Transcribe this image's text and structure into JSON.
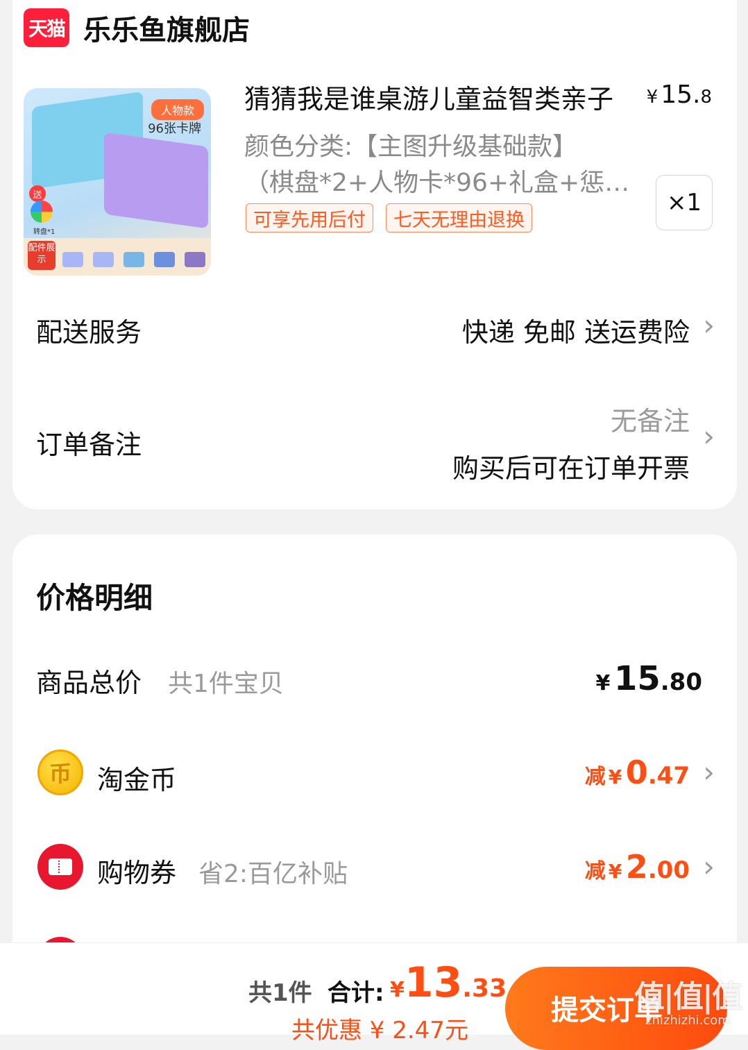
{
  "store": {
    "logo_text": "天猫",
    "name": "乐乐鱼旗舰店"
  },
  "product": {
    "image_tag": "人物款",
    "image_sub": "96张卡牌",
    "image_gift": "送",
    "image_spinner": "转盘*1",
    "image_parts_label": "配件展示",
    "title": "猜猜我是谁桌游儿童益智类亲子",
    "price_yen": "¥",
    "price_int": "15.",
    "price_dec": "8",
    "spec_line1": "颜色分类:【主图升级基础款】",
    "spec_line2": "（棋盘*2+人物卡*96+礼盒+惩…",
    "quantity": "×1",
    "badges": [
      "可享先用后付",
      "七天无理由退换"
    ]
  },
  "delivery": {
    "label": "配送服务",
    "value": "快递 免邮 送运费险"
  },
  "remark": {
    "label": "订单备注",
    "value": "无备注",
    "sub": "购买后可在订单开票"
  },
  "price_detail": {
    "title": "价格明细",
    "goods_label": "商品总价",
    "goods_sub": "共1件宝贝",
    "goods_yen": "¥",
    "goods_int": "15",
    "goods_dec": ".80",
    "coin": {
      "icon_glyph": "币",
      "label": "淘金币",
      "prefix": "减",
      "yen": "¥",
      "int": "0",
      "dec": ".47"
    },
    "coupon": {
      "label": "购物券",
      "sub": "省2:百亿补贴",
      "prefix": "减",
      "yen": "¥",
      "int": "2",
      "dec": ".00"
    }
  },
  "footer": {
    "count": "共1件",
    "total_label": "合计:",
    "total_yen": "¥",
    "total_int": "13",
    "total_dec": ".33",
    "saving": "共优惠 ¥ 2.47元",
    "submit_label": "提交订单",
    "watermark": "值|值|值",
    "watermark_sub": "zhizhizhi.com"
  },
  "colors": {
    "accent": "#ff4e14",
    "tmall_red": "#ff1f3a",
    "badge_border": "#ff8a5c",
    "button_gradient": [
      "#ff7a1a",
      "#ff4a0e"
    ]
  },
  "icons": {
    "chevron": "chevron-right-icon",
    "coin": "taojinbi-coin-icon",
    "coupon": "coupon-ticket-icon"
  }
}
